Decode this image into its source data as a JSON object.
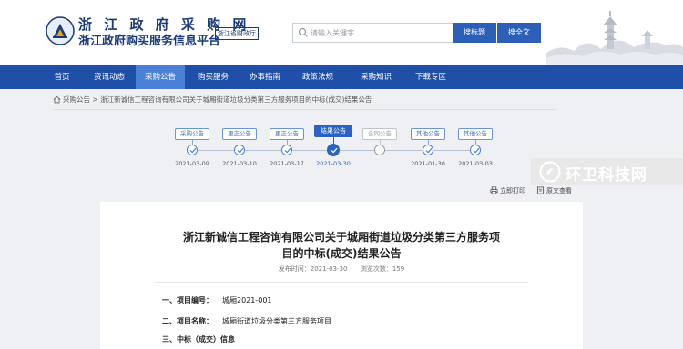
{
  "header": {
    "site_title": "浙 江 政 府 采 购 网",
    "site_subtitle": "浙江政府购买服务信息平台",
    "dept_badge": "浙江省财政厅",
    "search_placeholder": "请输入关键字",
    "search_title_button": "搜标题",
    "search_all_button": "搜全文"
  },
  "nav": {
    "items": [
      {
        "label": "首页",
        "active": false
      },
      {
        "label": "资讯动态",
        "active": false
      },
      {
        "label": "采购公告",
        "active": true
      },
      {
        "label": "购买服务",
        "active": false
      },
      {
        "label": "办事指南",
        "active": false
      },
      {
        "label": "政策法规",
        "active": false
      },
      {
        "label": "采购知识",
        "active": false
      },
      {
        "label": "下载专区",
        "active": false
      }
    ]
  },
  "breadcrumb": {
    "root": "采购公告",
    "separator": ">",
    "current": "浙江新诚信工程咨询有限公司关于城厢街道垃圾分类第三方服务项目的中标(成交)结果公告"
  },
  "timeline": {
    "steps": [
      {
        "label": "采购公告",
        "date": "2021-03-09",
        "state": "done"
      },
      {
        "label": "更正公告",
        "date": "2021-03-10",
        "state": "done"
      },
      {
        "label": "更正公告",
        "date": "2021-03-17",
        "state": "done"
      },
      {
        "label": "结果公告",
        "date": "2021-03-30",
        "state": "active"
      },
      {
        "label": "合同公告",
        "date": "",
        "state": "pending"
      },
      {
        "label": "其他公告",
        "date": "2021-01-30",
        "state": "done"
      },
      {
        "label": "其他公告",
        "date": "2021-03-03",
        "state": "done"
      }
    ]
  },
  "tools": {
    "print": "立即打印",
    "original": "原文查看"
  },
  "article": {
    "title_line1": "浙江新诚信工程咨询有限公司关于城厢街道垃圾分类第三方服务项",
    "title_line2": "目的中标(成交)结果公告",
    "publish_label": "发布时间：",
    "publish_time": "2021-03-30",
    "views_label": "浏览次数：",
    "views": "159",
    "sections": [
      {
        "key": "一、项目编号：",
        "value": "城厢2021-001"
      },
      {
        "key": "二、项目名称：",
        "value": "城厢街道垃圾分类第三方服务项目"
      },
      {
        "key": "三、中标（成交）信息",
        "value": ""
      }
    ]
  },
  "watermark": {
    "text": "环卫科技网"
  },
  "colors": {
    "nav_bg": "#1f4fa6",
    "nav_active": "#4a80d6",
    "accent": "#2b63c4",
    "title_blue": "#1a3a7a"
  }
}
